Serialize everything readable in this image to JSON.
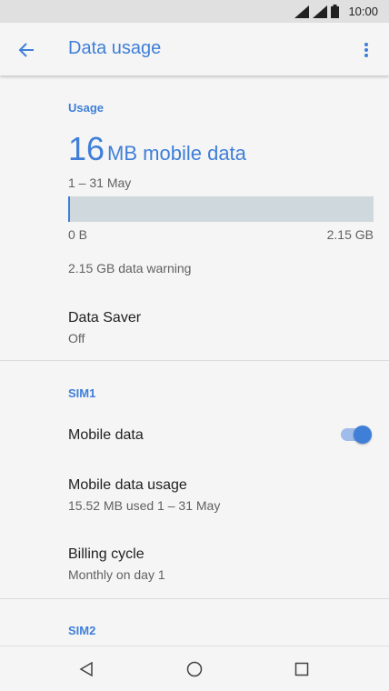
{
  "status_bar": {
    "time": "10:00"
  },
  "app_bar": {
    "title": "Data usage",
    "back_icon": "arrow-back-icon",
    "menu_icon": "more-vert-icon"
  },
  "usage": {
    "section_label": "Usage",
    "amount": "16",
    "amount_unit": "MB mobile data",
    "period": "1 – 31 May",
    "bar_fraction": 0.0073,
    "bar_min_label": "0 B",
    "bar_max_label": "2.15 GB",
    "warning": "2.15 GB data warning"
  },
  "data_saver": {
    "title": "Data Saver",
    "value": "Off"
  },
  "sim1": {
    "section_label": "SIM1",
    "mobile_data": {
      "title": "Mobile data",
      "enabled": true
    },
    "mobile_data_usage": {
      "title": "Mobile data usage",
      "summary": "15.52 MB used 1 – 31 May"
    },
    "billing_cycle": {
      "title": "Billing cycle",
      "summary": "Monthly on day 1"
    }
  },
  "sim2": {
    "section_label": "SIM2"
  },
  "nav_bar": {
    "back_icon": "nav-back-icon",
    "home_icon": "nav-home-icon",
    "recents_icon": "nav-recents-icon"
  },
  "colors": {
    "accent": "#3f7fd8",
    "bar_track": "#cfd8dc",
    "toggle_track": "#9fbcea"
  }
}
